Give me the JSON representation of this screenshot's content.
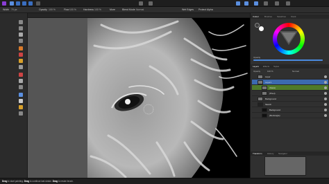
{
  "toolbar": {
    "persona_icons": [
      "affinity-logo-icon",
      "photo-persona-icon",
      "liquify-persona-icon",
      "develop-persona-icon",
      "tone-mapping-persona-icon",
      "export-persona-icon"
    ],
    "right_icons": [
      "color-picker-icon",
      "snapping-icon",
      "assistant-icon",
      "view-mode-icon",
      "arrange-icon",
      "share-icon"
    ]
  },
  "context_bar": {
    "width_label": "Width",
    "width_value": "70 px",
    "opacity_label": "Opacity",
    "opacity_value": "100 %",
    "flow_label": "Flow",
    "flow_value": "100 %",
    "hardness_label": "Hardness",
    "hardness_value": "100 %",
    "more_label": "More",
    "blend_label": "Blend Mode",
    "blend_value": "Normal",
    "wet_edges_label": "Wet Edges",
    "protect_alpha_label": "Protect Alpha"
  },
  "document_tab": {
    "title": ""
  },
  "tools": [
    "move-tool-icon",
    "view-tool-icon",
    "selection-tool-icon",
    "crop-tool-icon",
    "paint-brush-icon",
    "erase-brush-icon",
    "fill-tool-icon",
    "gradient-tool-icon",
    "clone-tool-icon",
    "dodge-tool-icon",
    "blur-brush-icon",
    "pen-tool-icon",
    "text-tool-icon",
    "shape-tool-icon",
    "zoom-tool-icon"
  ],
  "color_panel": {
    "tabs": [
      "Colour",
      "Brushes",
      "Swatches",
      "Stock"
    ],
    "active_tab": "Colour",
    "opacity_label": "Opacity",
    "primary_color": "#3a3a3a",
    "secondary_color": "#ffffff"
  },
  "layers_panel": {
    "tabs": [
      "Layers",
      "Effects",
      "Styles"
    ],
    "active_tab": "Layers",
    "opacity_label": "Opacity",
    "opacity_value": "100 %",
    "blend_value": "Normal",
    "layers": [
      {
        "name": "Layer",
        "kind": "Pixel",
        "style": "normal"
      },
      {
        "name": "Layer1",
        "kind": "Pixel",
        "style": "selected"
      },
      {
        "name": "(Mask)",
        "kind": "",
        "style": "green"
      },
      {
        "name": "(Pixel)",
        "kind": "",
        "style": "normal"
      },
      {
        "name": "Background",
        "kind": "Pixel",
        "style": "normal"
      },
      {
        "name": "Sketch",
        "kind": "",
        "style": "normal"
      },
      {
        "name": "Background",
        "kind": "Pixel",
        "style": "normal"
      },
      {
        "name": "(Rectangle)",
        "kind": "",
        "style": "normal"
      }
    ]
  },
  "transform_panel": {
    "tabs": [
      "Transform",
      "History",
      "Navigator"
    ],
    "active_tab": "Transform"
  },
  "status_bar": {
    "key1": "Drag",
    "text1": "to start painting.",
    "key2": "Drag",
    "text2": "to continue last stroke.",
    "key3": "Drag",
    "text3": "to resize brush."
  },
  "colors": {
    "accent": "#4a8ae0",
    "selected_layer": "#3c6ab0",
    "mask_layer": "#4f7a2a"
  }
}
